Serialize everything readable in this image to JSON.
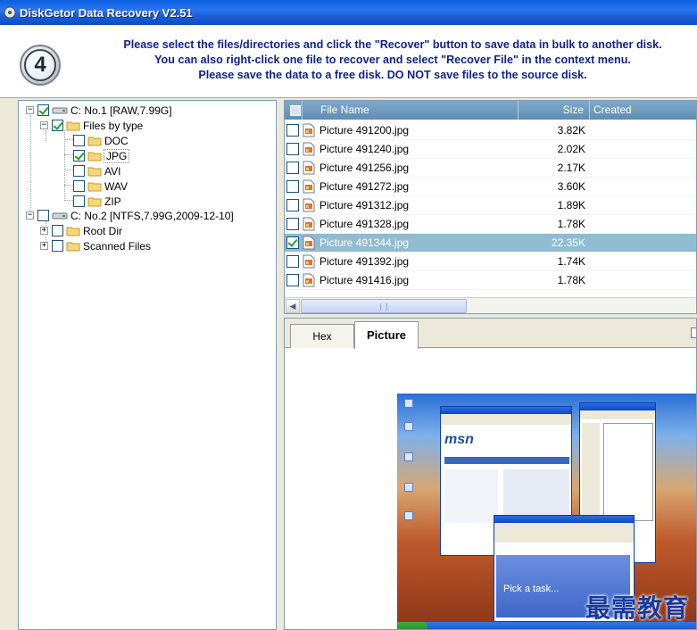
{
  "window": {
    "title": "DiskGetor Data Recovery V2.51"
  },
  "header": {
    "step": "4",
    "lines": [
      "Please select the files/directories and click the \"Recover\" button to save data in bulk to another disk.",
      "You can also right-click one file to recover and select \"Recover File\" in the context menu.",
      "Please save the data to a free disk. DO NOT save files to the source disk."
    ]
  },
  "tree": {
    "disk1": {
      "label": "C: No.1 [RAW,7.99G]",
      "expander": "−",
      "checked": true
    },
    "files_by_type": {
      "label": "Files by type",
      "expander": "−",
      "checked": true
    },
    "types": [
      {
        "label": "DOC",
        "checked": false
      },
      {
        "label": "JPG",
        "checked": true
      },
      {
        "label": "AVI",
        "checked": false
      },
      {
        "label": "WAV",
        "checked": false
      },
      {
        "label": "ZIP",
        "checked": false
      }
    ],
    "disk2": {
      "label": "C: No.2 [NTFS,7.99G,2009-12-10]",
      "expander": "−",
      "checked": false
    },
    "root_dir": {
      "label": "Root Dir",
      "expander": "+",
      "checked": false
    },
    "scanned_files": {
      "label": "Scanned Files",
      "expander": "+",
      "checked": false
    }
  },
  "file_list": {
    "columns": {
      "name": "File Name",
      "size": "Size",
      "created": "Created"
    },
    "rows": [
      {
        "name": "Picture 491200.jpg",
        "size": "3.82K",
        "checked": false,
        "selected": false
      },
      {
        "name": "Picture 491240.jpg",
        "size": "2.02K",
        "checked": false,
        "selected": false
      },
      {
        "name": "Picture 491256.jpg",
        "size": "2.17K",
        "checked": false,
        "selected": false
      },
      {
        "name": "Picture 491272.jpg",
        "size": "3.60K",
        "checked": false,
        "selected": false
      },
      {
        "name": "Picture 491312.jpg",
        "size": "1.89K",
        "checked": false,
        "selected": false
      },
      {
        "name": "Picture 491328.jpg",
        "size": "1.78K",
        "checked": false,
        "selected": false
      },
      {
        "name": "Picture 491344.jpg",
        "size": "22.35K",
        "checked": true,
        "selected": true
      },
      {
        "name": "Picture 491392.jpg",
        "size": "1.74K",
        "checked": false,
        "selected": false
      },
      {
        "name": "Picture 491416.jpg",
        "size": "1.78K",
        "checked": false,
        "selected": false
      }
    ]
  },
  "preview": {
    "tabs": {
      "hex": "Hex",
      "picture": "Picture"
    },
    "active_tab": "Picture"
  },
  "watermark": "最需教育",
  "colors": {
    "accent_header": "#0F238C",
    "selected_row": "#8fbcd1",
    "grid_header": "#6f9bbf"
  }
}
